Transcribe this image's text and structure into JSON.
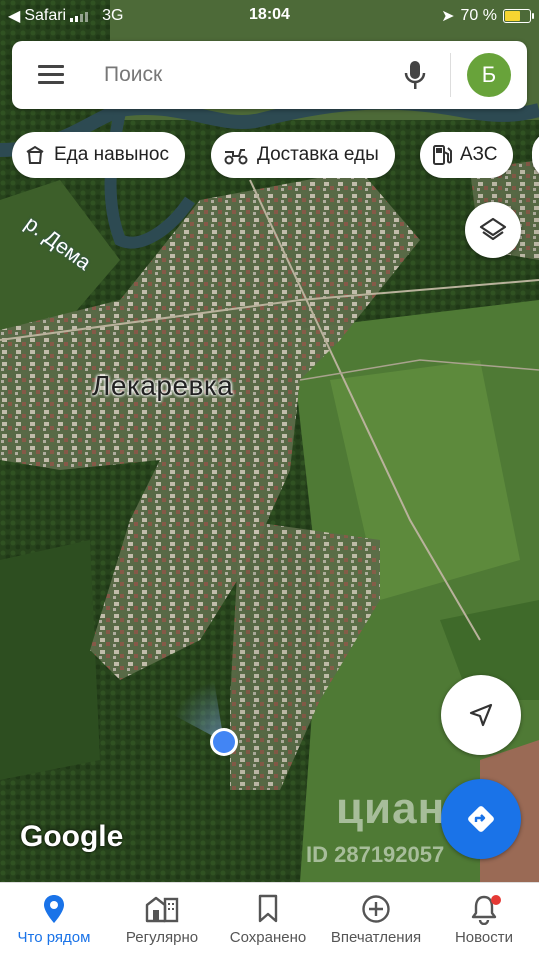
{
  "status_bar": {
    "back_app": "Safari",
    "network": "3G",
    "time": "18:04",
    "battery": "70 %",
    "battery_level": 0.7
  },
  "search": {
    "placeholder": "Поиск",
    "avatar_letter": "Б"
  },
  "chips": [
    {
      "label": "Еда навынос",
      "icon": "takeout-icon"
    },
    {
      "label": "Доставка еды",
      "icon": "delivery-scooter-icon"
    },
    {
      "label": "АЗС",
      "icon": "gas-station-icon"
    }
  ],
  "map": {
    "place_label": "Лекаревка",
    "river_label": "р. Дема",
    "attribution": "Google",
    "watermark_brand": "циан",
    "watermark_id": "ID 287192057"
  },
  "tabs": [
    {
      "label": "Что рядом",
      "icon": "place-pin-icon",
      "active": true
    },
    {
      "label": "Регулярно",
      "icon": "commute-icon"
    },
    {
      "label": "Сохранено",
      "icon": "bookmark-icon"
    },
    {
      "label": "Впечатления",
      "icon": "add-circle-icon"
    },
    {
      "label": "Новости",
      "icon": "bell-icon"
    }
  ],
  "colors": {
    "accent": "#1a73e8",
    "avatar": "#68a33a",
    "battery": "#f7d531"
  }
}
